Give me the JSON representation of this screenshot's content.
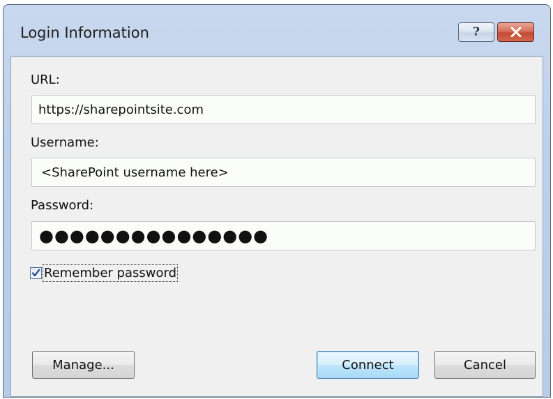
{
  "window": {
    "title": "Login Information",
    "help_label": "?",
    "close_label": "✕"
  },
  "form": {
    "url_label": "URL:",
    "url_value": "https://sharepointsite.com",
    "username_label": "Username:",
    "username_value": "<SharePoint username here>",
    "password_label": "Password:",
    "password_value": "●●●●●●●●●●●●●●●",
    "remember_label": "Remember password",
    "remember_checked": true
  },
  "buttons": {
    "manage": "Manage...",
    "connect": "Connect",
    "cancel": "Cancel"
  },
  "icons": {
    "help": "question-icon",
    "close": "close-icon",
    "check": "checkmark-icon"
  }
}
